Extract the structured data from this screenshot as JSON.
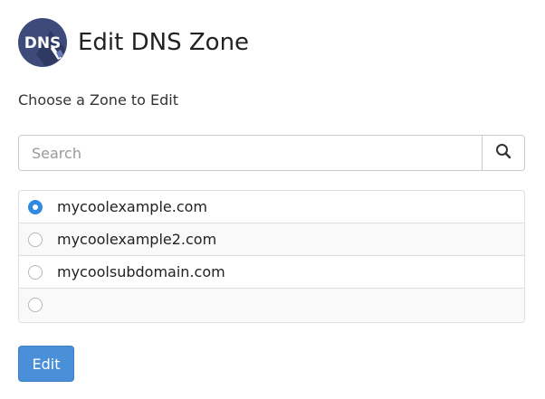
{
  "header": {
    "icon_text": "DNS",
    "icon_name": "dns-icon",
    "title": "Edit DNS Zone"
  },
  "subtitle": "Choose a Zone to Edit",
  "search": {
    "placeholder": "Search",
    "value": "",
    "button_icon": "search-icon"
  },
  "zones": [
    {
      "label": "mycoolexample.com",
      "selected": true
    },
    {
      "label": "mycoolexample2.com",
      "selected": false
    },
    {
      "label": "mycoolsubdomain.com",
      "selected": false
    },
    {
      "label": "",
      "selected": false
    }
  ],
  "edit_button": {
    "label": "Edit"
  },
  "colors": {
    "accent": "#2f8ae0",
    "button": "#4a90d9",
    "icon_bg": "#3d4a7a"
  }
}
